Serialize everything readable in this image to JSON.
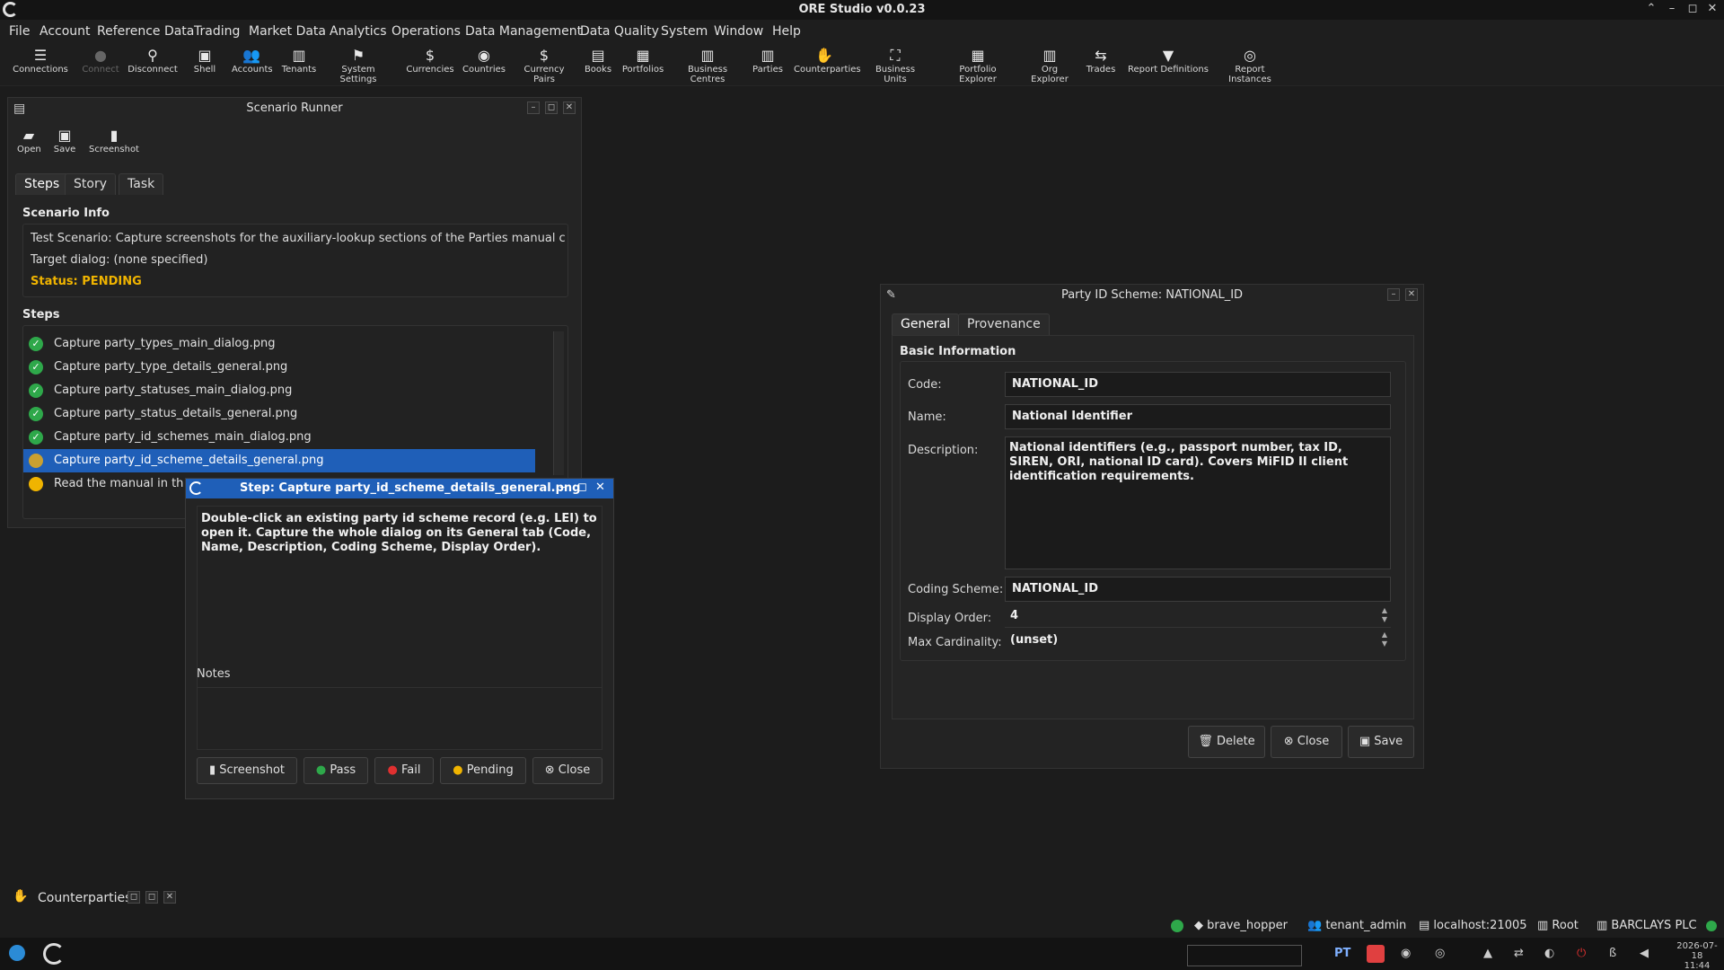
{
  "app": {
    "title": "ORE Studio v0.0.23"
  },
  "menu": [
    "File",
    "Account",
    "Reference Data",
    "Trading",
    "Market Data",
    "Analytics",
    "Operations",
    "Data Management",
    "Data Quality",
    "System",
    "Window",
    "Help"
  ],
  "toolbar": [
    {
      "label": "Connections",
      "icon": "connections-icon",
      "glyph": "☰"
    },
    {
      "label": "Connect",
      "icon": "connect-icon",
      "glyph": "●"
    },
    {
      "label": "Disconnect",
      "icon": "disconnect-icon",
      "glyph": "⚲"
    },
    {
      "label": "Shell",
      "icon": "shell-icon",
      "glyph": "▣"
    },
    {
      "label": "Accounts",
      "icon": "accounts-icon",
      "glyph": "👥"
    },
    {
      "label": "Tenants",
      "icon": "tenants-icon",
      "glyph": "▥"
    },
    {
      "label": "System Settings",
      "icon": "flag-icon",
      "glyph": "⚑"
    },
    {
      "label": "Currencies",
      "icon": "currency-icon",
      "glyph": "$"
    },
    {
      "label": "Countries",
      "icon": "globe-icon",
      "glyph": "◉"
    },
    {
      "label": "Currency Pairs",
      "icon": "currency-pairs-icon",
      "glyph": "$"
    },
    {
      "label": "Books",
      "icon": "books-icon",
      "glyph": "▤"
    },
    {
      "label": "Portfolios",
      "icon": "portfolio-icon",
      "glyph": "▦"
    },
    {
      "label": "Business Centres",
      "icon": "building-icon",
      "glyph": "▥"
    },
    {
      "label": "Parties",
      "icon": "parties-icon",
      "glyph": "▥"
    },
    {
      "label": "Counterparties",
      "icon": "handshake-icon",
      "glyph": "✋"
    },
    {
      "label": "Business Units",
      "icon": "business-units-icon",
      "glyph": "⛶"
    },
    {
      "label": "Portfolio Explorer",
      "icon": "portfolio-explorer-icon",
      "glyph": "▦"
    },
    {
      "label": "Org Explorer",
      "icon": "org-explorer-icon",
      "glyph": "▥"
    },
    {
      "label": "Trades",
      "icon": "trades-icon",
      "glyph": "⇆"
    },
    {
      "label": "Report Definitions",
      "icon": "report-definitions-icon",
      "glyph": "▼"
    },
    {
      "label": "Report Instances",
      "icon": "report-instances-icon",
      "glyph": "◎"
    }
  ],
  "scenario": {
    "title": "Scenario Runner",
    "toolbar": {
      "open": "Open",
      "save": "Save",
      "screenshot": "Screenshot"
    },
    "tabs": [
      "Steps",
      "Story",
      "Task"
    ],
    "info_title": "Scenario Info",
    "info_line1": "Test Scenario: Capture screenshots for the auxiliary-lookup sections of the Parties manual chapte",
    "info_line2": "Target dialog: (none specified)",
    "status": "Status: PENDING",
    "steps_title": "Steps",
    "steps": [
      {
        "label": "Capture party_types_main_dialog.png",
        "state": "pass"
      },
      {
        "label": "Capture party_type_details_general.png",
        "state": "pass"
      },
      {
        "label": "Capture party_statuses_main_dialog.png",
        "state": "pass"
      },
      {
        "label": "Capture party_status_details_general.png",
        "state": "pass"
      },
      {
        "label": "Capture party_id_schemes_main_dialog.png",
        "state": "pass"
      },
      {
        "label": "Capture party_id_scheme_details_general.png",
        "state": "current"
      },
      {
        "label": "Read the manual in th",
        "state": "pending"
      }
    ]
  },
  "step_dialog": {
    "title": "Step: Capture party_id_scheme_details_general.png",
    "instructions": "Double-click an existing party id scheme record (e.g. LEI) to open it. Capture the whole dialog on its General tab (Code, Name, Description, Coding Scheme, Display Order).",
    "notes_label": "Notes",
    "buttons": {
      "screenshot": "Screenshot",
      "pass": "Pass",
      "fail": "Fail",
      "pending": "Pending",
      "close": "Close"
    }
  },
  "party_dialog": {
    "title": "Party ID Scheme: NATIONAL_ID",
    "tabs": [
      "General",
      "Provenance"
    ],
    "section": "Basic Information",
    "labels": {
      "code": "Code:",
      "name": "Name:",
      "description": "Description:",
      "coding_scheme": "Coding Scheme:",
      "display_order": "Display Order:",
      "max_cardinality": "Max Cardinality:"
    },
    "values": {
      "code": "NATIONAL_ID",
      "name": "National Identifier",
      "description": "National identifiers (e.g., passport number, tax ID, SIREN, ORI, national ID card). Covers MiFID II client identification requirements.",
      "coding_scheme": "NATIONAL_ID",
      "display_order": "4",
      "max_cardinality": "(unset)"
    },
    "buttons": {
      "delete": "Delete",
      "close": "Close",
      "save": "Save"
    }
  },
  "counterparties_panel": {
    "title": "Counterparties"
  },
  "statusbar": {
    "user": "brave_hopper",
    "tenant": "tenant_admin",
    "server": "localhost:21005",
    "root": "Root",
    "party": "BARCLAYS PLC"
  },
  "taskbar": {
    "lang": "PT",
    "date": "2026-07-18",
    "time": "11:44"
  },
  "colors": {
    "accent": "#1f5fb8",
    "pass": "#2ea84a",
    "pending": "#f0b400",
    "fail": "#e03030",
    "status_text": "#f0b400"
  }
}
